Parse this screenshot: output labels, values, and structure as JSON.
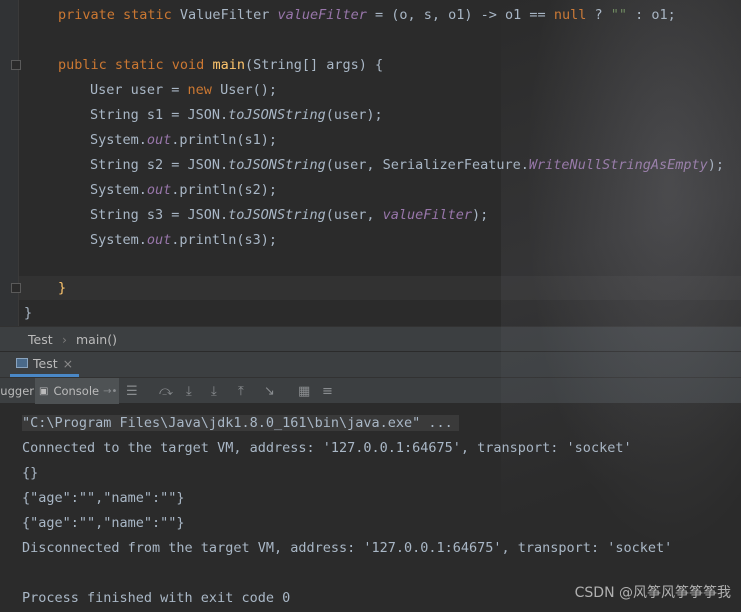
{
  "editor": {
    "line_private_kw": "private static",
    "line_private_type": " ValueFilter ",
    "line_private_field": "valueFilter",
    "line_private_rest1": " = (o, s, o1) -> o1 == ",
    "line_private_null": "null",
    "line_private_rest2": " ? ",
    "line_private_str": "\"\"",
    "line_private_rest3": " : o1;",
    "main_kw": "public static void ",
    "main_name": "main",
    "main_params": "(String[] args) {",
    "l1_pre": "User user = ",
    "l1_new": "new",
    "l1_post": " User();",
    "l2_pre": "String s1 = JSON.",
    "l2_m": "toJSONString",
    "l2_post": "(user);",
    "l3_pre": "System.",
    "l3_out": "out",
    "l3_post": ".println(s1);",
    "l4_pre": "String s2 = JSON.",
    "l4_m": "toJSONString",
    "l4_mid": "(user, SerializerFeature.",
    "l4_field": "WriteNullStringAsEmpty",
    "l4_post": ");",
    "l5_pre": "System.",
    "l5_out": "out",
    "l5_post": ".println(s2);",
    "l6_pre": "String s3 = JSON.",
    "l6_m": "toJSONString",
    "l6_mid": "(user, ",
    "l6_field": "valueFilter",
    "l6_post": ");",
    "l7_pre": "System.",
    "l7_out": "out",
    "l7_post": ".println(s3);",
    "close_brace": "}",
    "class_close": "}"
  },
  "breadcrumb": {
    "class_name": "Test",
    "separator": "›",
    "method": "main()"
  },
  "run_tab": {
    "label": "Test",
    "close": "×"
  },
  "toolbar": {
    "debugger_label": "Debugger",
    "console_label": "Console"
  },
  "console": {
    "cmd": "\"C:\\Program Files\\Java\\jdk1.8.0_161\\bin\\java.exe\" ...",
    "connected": "Connected to the target VM, address: '127.0.0.1:64675', transport: 'socket'",
    "out1": "{}",
    "out2": "{\"age\":\"\",\"name\":\"\"}",
    "out3": "{\"age\":\"\",\"name\":\"\"}",
    "disconnected": "Disconnected from the target VM, address: '127.0.0.1:64675', transport: 'socket'",
    "finished": "Process finished with exit code 0"
  },
  "watermark": "CSDN @风筝风筝筝筝我",
  "colors": {
    "background": "#2b2b2b",
    "keyword": "#cc7832",
    "field": "#9876aa",
    "method": "#ffc66d",
    "string": "#6a8759",
    "text": "#a9b7c6",
    "tab_underline": "#4a88c7"
  }
}
